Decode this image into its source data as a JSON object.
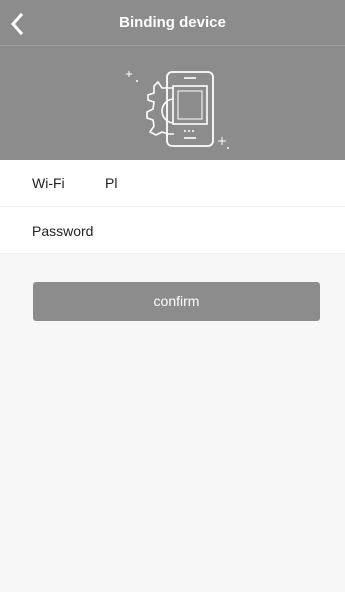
{
  "header": {
    "title": "Binding device",
    "back_icon": "chevron-left-icon",
    "illustration_icon": "phone-gear-icon"
  },
  "form": {
    "wifi": {
      "label": "Wi-Fi",
      "value": "Pl"
    },
    "password": {
      "placeholder": "Password",
      "value": ""
    }
  },
  "actions": {
    "confirm_label": "confirm"
  },
  "colors": {
    "header_bg": "#8c8c8c",
    "button_bg": "#8c8c8c",
    "page_bg": "#f7f7f7"
  }
}
